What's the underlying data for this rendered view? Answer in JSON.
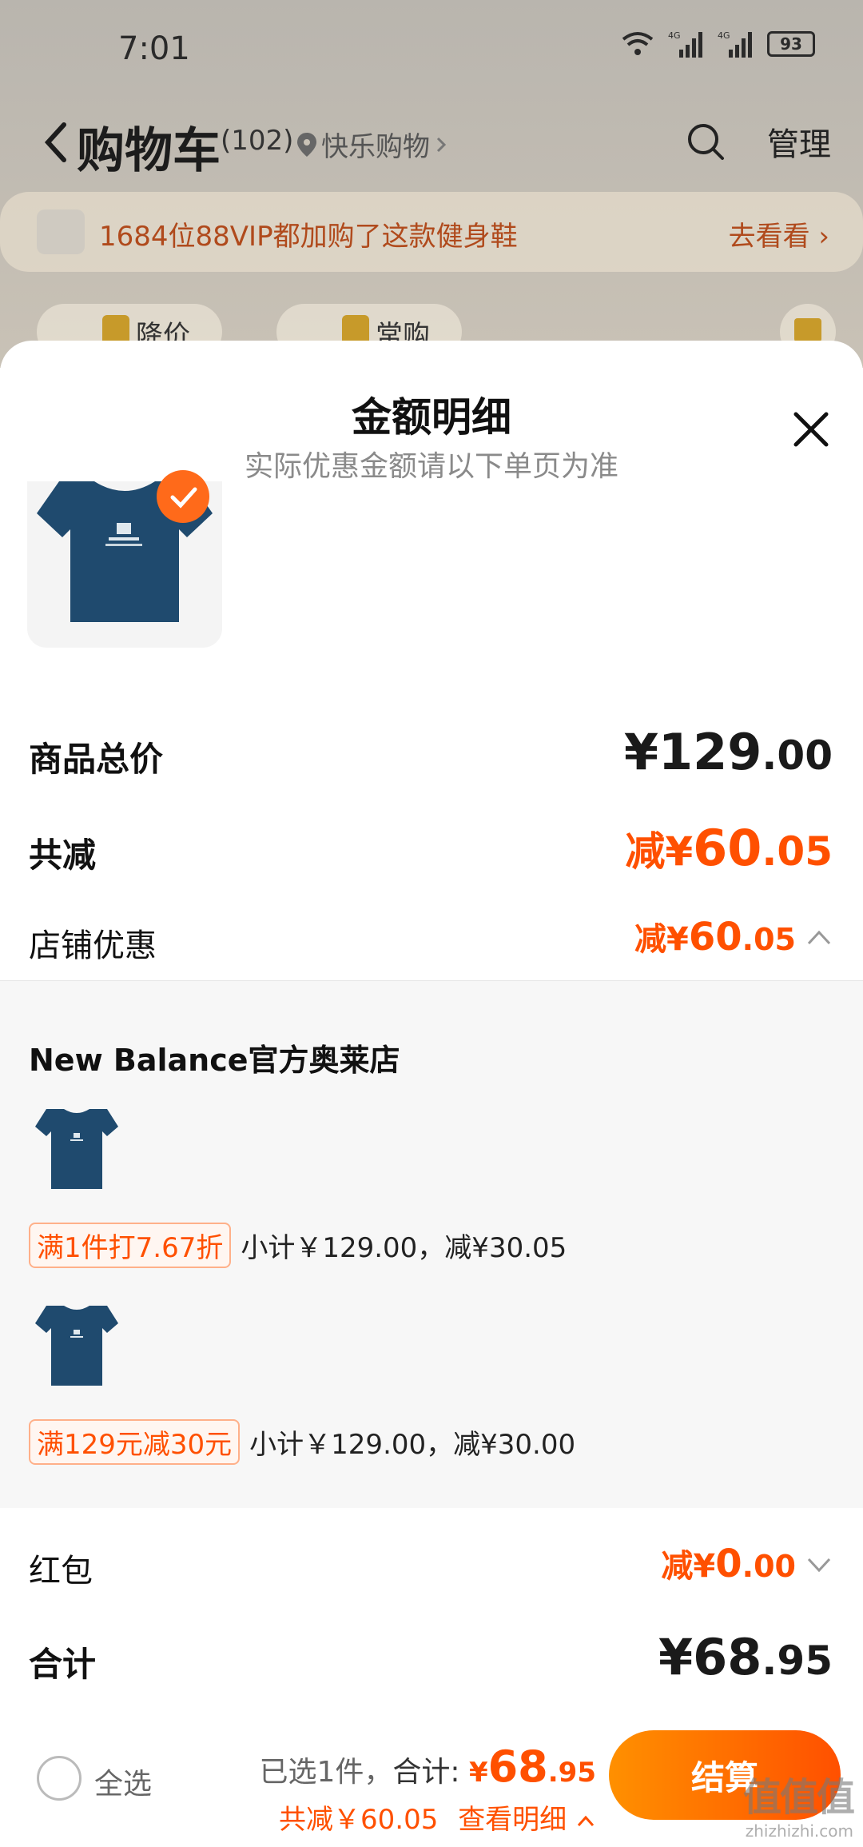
{
  "status_bar": {
    "time": "7:01",
    "network": "4G",
    "battery": "93"
  },
  "cart_header": {
    "title": "购物车",
    "count": "(102)",
    "location": "快乐购物",
    "manage": "管理"
  },
  "vip_banner": {
    "text": "1684位88VIP都加购了这款健身鞋",
    "link": "去看看"
  },
  "filter_chips": [
    "降价",
    "常购"
  ],
  "sheet": {
    "title": "金额明细",
    "subtitle": "实际优惠金额请以下单页为准",
    "product_total": {
      "label": "商品总价",
      "currency": "¥",
      "int": "129",
      "dec": ".00"
    },
    "total_discount": {
      "label": "共减",
      "prefix": "减¥",
      "int": "60",
      "dec": ".05"
    },
    "store_discount": {
      "label": "店铺优惠",
      "prefix": "减¥",
      "int": "60",
      "dec": ".05"
    },
    "detail": {
      "store": "New Balance官方奥莱店",
      "items": [
        {
          "tag": "满1件打7.67折",
          "text": "小计￥129.00，减¥30.05"
        },
        {
          "tag": "满129元减30元",
          "text": "小计￥129.00，减¥30.00"
        }
      ]
    },
    "red_packet": {
      "label": "红包",
      "prefix": "减¥",
      "int": "0",
      "dec": ".00"
    },
    "grand_total": {
      "label": "合计",
      "currency": "¥",
      "int": "68",
      "dec": ".95"
    }
  },
  "bottom_bar": {
    "select_all": "全选",
    "selected": "已选1件，",
    "total_label": "合计: ",
    "total_currency": "¥",
    "total_int": "68",
    "total_dec": ".95",
    "discount_text": "共减￥60.05",
    "view_detail": "查看明细",
    "checkout": "结算"
  },
  "watermark": {
    "logo": "值值值",
    "url": "zhizhizhi.com"
  },
  "colors": {
    "accent": "#ff5000",
    "accent_light": "#ff9000",
    "tshirt": "#1f4a6e"
  }
}
